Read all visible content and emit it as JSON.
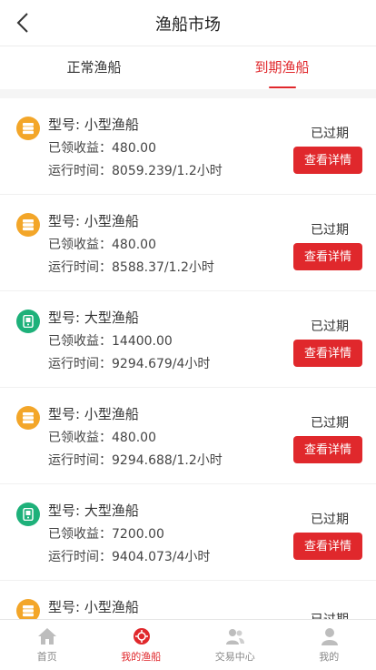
{
  "header": {
    "title": "渔船市场"
  },
  "tabs": [
    {
      "label": "正常渔船"
    },
    {
      "label": "到期渔船"
    }
  ],
  "colors": {
    "accent": "#e0282c",
    "small_boat": "#f3a629",
    "large_boat": "#1eb17a"
  },
  "cards": [
    {
      "type_label": "型号: 小型渔船",
      "income": "已领收益：480.00",
      "runtime": "运行时间：8059.239/1.2小时",
      "status": "已过期",
      "button": "查看详情",
      "icon": "server-icon"
    },
    {
      "type_label": "型号: 小型渔船",
      "income": "已领收益：480.00",
      "runtime": "运行时间：8588.37/1.2小时",
      "status": "已过期",
      "button": "查看详情",
      "icon": "server-icon"
    },
    {
      "type_label": "型号: 大型渔船",
      "income": "已领收益：14400.00",
      "runtime": "运行时间：9294.679/4小时",
      "status": "已过期",
      "button": "查看详情",
      "icon": "device-icon"
    },
    {
      "type_label": "型号: 小型渔船",
      "income": "已领收益：480.00",
      "runtime": "运行时间：9294.688/1.2小时",
      "status": "已过期",
      "button": "查看详情",
      "icon": "server-icon"
    },
    {
      "type_label": "型号: 大型渔船",
      "income": "已领收益：7200.00",
      "runtime": "运行时间：9404.073/4小时",
      "status": "已过期",
      "button": "查看详情",
      "icon": "device-icon"
    },
    {
      "type_label": "型号: 小型渔船",
      "income": "",
      "runtime": "",
      "status": "已过期",
      "button": "",
      "icon": "server-icon"
    }
  ],
  "nav": [
    {
      "label": "首页",
      "icon": "home-icon"
    },
    {
      "label": "我的渔船",
      "icon": "boat-icon",
      "active": true
    },
    {
      "label": "交易中心",
      "icon": "users-icon"
    },
    {
      "label": "我的",
      "icon": "user-icon"
    }
  ]
}
